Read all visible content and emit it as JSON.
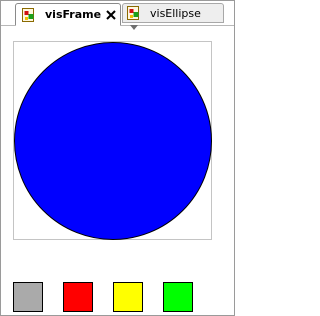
{
  "tabs": [
    {
      "label": "visFrame",
      "active": true,
      "closable": true,
      "icon": "vis-document-icon"
    },
    {
      "label": "visEllipse",
      "active": false,
      "closable": false,
      "icon": "vis-document-icon"
    }
  ],
  "canvas": {
    "frame_border_color": "#c4c4c4",
    "ellipse_fill": "#0000ff",
    "ellipse_stroke": "#000000"
  },
  "swatches": [
    {
      "name": "gray",
      "color": "#aaaaaa"
    },
    {
      "name": "red",
      "color": "#ff0000"
    },
    {
      "name": "yellow",
      "color": "#ffff00"
    },
    {
      "name": "green",
      "color": "#00ff00"
    }
  ]
}
